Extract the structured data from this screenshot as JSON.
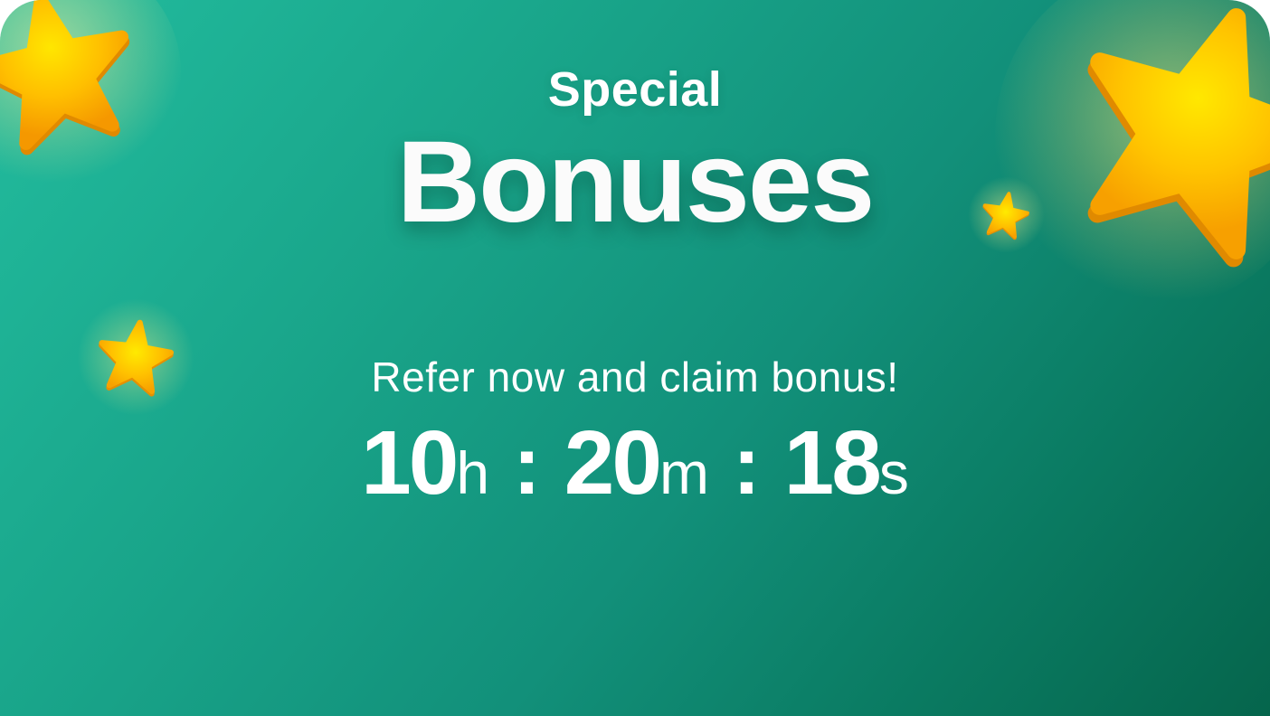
{
  "banner": {
    "title_line1": "Special",
    "title_line2": "Bonuses",
    "subtitle": "Refer now and claim bonus!",
    "timer": {
      "hours": "10",
      "hours_unit": "h",
      "minutes": "20",
      "minutes_unit": "m",
      "seconds": "18",
      "seconds_unit": "s",
      "separator": ":"
    }
  },
  "decorations": {
    "icon": "star-icon",
    "star_colors": [
      "#ffe500",
      "#ffb400",
      "#f59a00"
    ],
    "background_colors": [
      "#22bc9e",
      "#05654c"
    ]
  }
}
